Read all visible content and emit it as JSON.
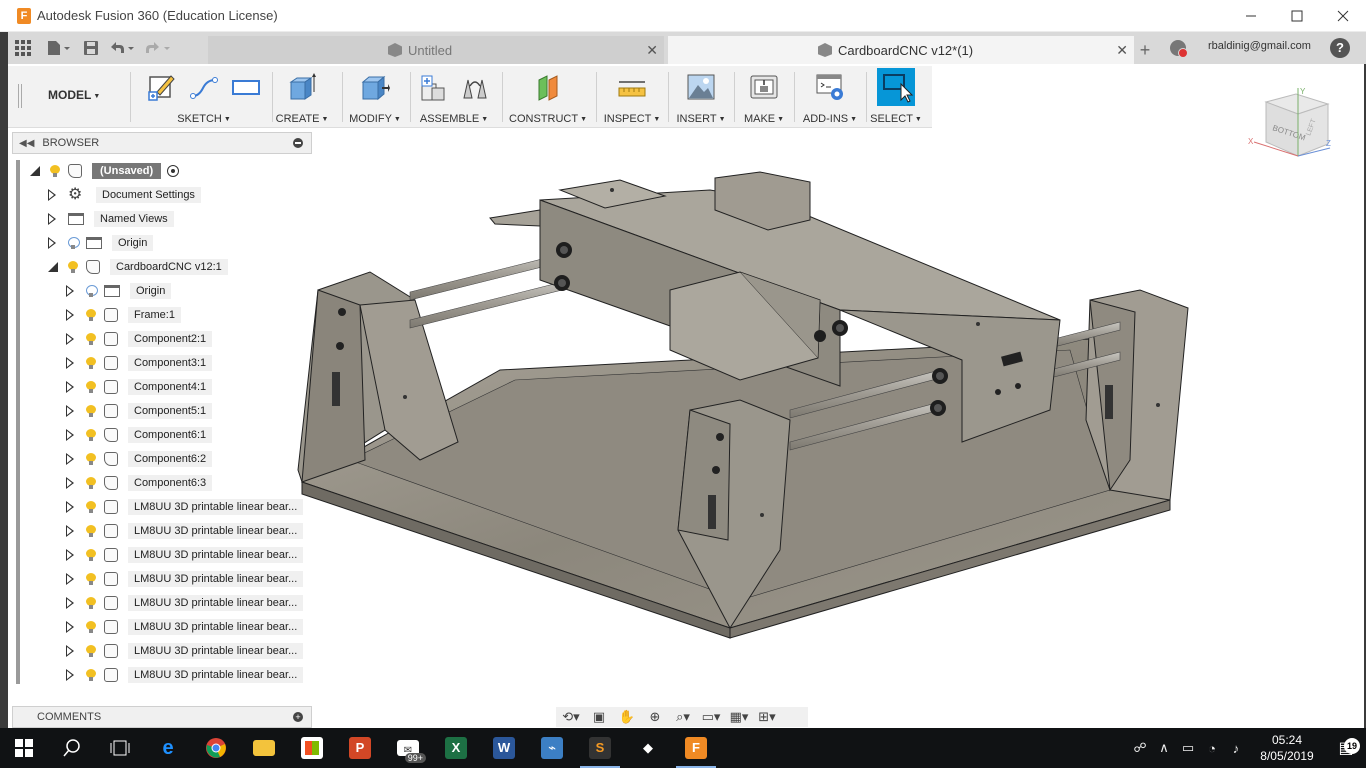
{
  "window": {
    "title": "Autodesk Fusion 360 (Education License)",
    "minimize_icon": "minimize-icon",
    "maximize_icon": "maximize-icon",
    "close_icon": "close-icon"
  },
  "appbar": {
    "tabs": [
      {
        "label": "Untitled",
        "active": false
      },
      {
        "label": "CardboardCNC v12*(1)",
        "active": true
      }
    ],
    "user_email": "rbaldinig@gmail.com",
    "help_label": "?"
  },
  "toolbar": {
    "workspace": "MODEL",
    "groups": [
      {
        "label": "SKETCH"
      },
      {
        "label": "CREATE"
      },
      {
        "label": "MODIFY"
      },
      {
        "label": "ASSEMBLE"
      },
      {
        "label": "CONSTRUCT"
      },
      {
        "label": "INSPECT"
      },
      {
        "label": "INSERT"
      },
      {
        "label": "MAKE"
      },
      {
        "label": "ADD-INS"
      },
      {
        "label": "SELECT"
      }
    ],
    "accent_color": "#0696d7"
  },
  "browser": {
    "title": "BROWSER",
    "root": {
      "label": "(Unsaved)"
    },
    "items": [
      {
        "label": "Document Settings"
      },
      {
        "label": "Named Views"
      },
      {
        "label": "Origin"
      },
      {
        "label": "CardboardCNC v12:1"
      }
    ],
    "children": [
      {
        "label": "Origin"
      },
      {
        "label": "Frame:1"
      },
      {
        "label": "Component2:1"
      },
      {
        "label": "Component3:1"
      },
      {
        "label": "Component4:1"
      },
      {
        "label": "Component5:1"
      },
      {
        "label": "Component6:1"
      },
      {
        "label": "Component6:2"
      },
      {
        "label": "Component6:3"
      },
      {
        "label": "LM8UU 3D printable linear bear..."
      },
      {
        "label": "LM8UU 3D printable linear bear..."
      },
      {
        "label": "LM8UU 3D printable linear bear..."
      },
      {
        "label": "LM8UU 3D printable linear bear..."
      },
      {
        "label": "LM8UU 3D printable linear bear..."
      },
      {
        "label": "LM8UU 3D printable linear bear..."
      },
      {
        "label": "LM8UU 3D printable linear bear..."
      },
      {
        "label": "LM8UU 3D printable linear bear..."
      }
    ]
  },
  "comments": {
    "title": "COMMENTS"
  },
  "viewcube": {
    "face": "BOTTOM",
    "side": "LEFT",
    "axis_x": "X",
    "axis_y": "Y",
    "axis_z": "Z"
  },
  "taskbar": {
    "time": "05:24",
    "date": "8/05/2019",
    "mail_badge": "99+",
    "notification_count": "19"
  }
}
